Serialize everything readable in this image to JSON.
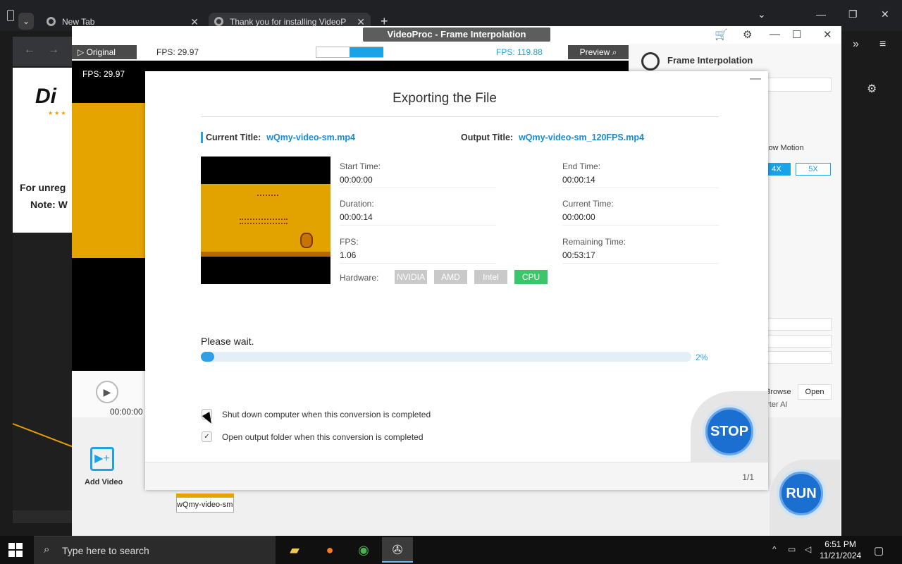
{
  "browser": {
    "tabs": [
      {
        "label": "New Tab"
      },
      {
        "label": "Thank you for installing VideoP"
      }
    ],
    "page": {
      "headline": "Di",
      "line1": "For unreg",
      "line2": "Note: W"
    }
  },
  "app": {
    "window_title": "VideoProc - Frame Interpolation",
    "original_label": "Original",
    "fps_left": "FPS: 29.97",
    "fps_right": "FPS: 119.88",
    "preview_label": "Preview",
    "video_fps_overlay": "FPS: 29.97",
    "time_display": "00:00:00",
    "panel": {
      "title": "Frame Interpolation",
      "slow_motion_label": "low Motion",
      "btn_4x": "4X",
      "btn_5x": "5X",
      "label_4": "4",
      "browse": "Browse",
      "open": "Open",
      "converter": "erter AI"
    },
    "add_video_label": "Add Video",
    "thumb_label": "wQmy-video-sm.",
    "run_label": "RUN"
  },
  "dialog": {
    "title": "Exporting the File",
    "current_title_label": "Current Title:",
    "current_title_value": "wQmy-video-sm.mp4",
    "output_title_label": "Output Title:",
    "output_title_value": "wQmy-video-sm_120FPS.mp4",
    "fields": {
      "start_time_label": "Start Time:",
      "start_time": "00:00:00",
      "end_time_label": "End Time:",
      "end_time": "00:00:14",
      "duration_label": "Duration:",
      "duration": "00:00:14",
      "current_time_label": "Current Time:",
      "current_time": "00:00:00",
      "fps_label": "FPS:",
      "fps": "1.06",
      "remaining_label": "Remaining Time:",
      "remaining": "00:53:17"
    },
    "hardware_label": "Hardware:",
    "hardware": [
      "NVIDIA",
      "AMD",
      "Intel",
      "CPU"
    ],
    "hardware_active": "CPU",
    "status_text": "Please wait.",
    "progress_percent": 2,
    "progress_label": "2%",
    "shutdown_label": "Shut down computer when this conversion is completed",
    "shutdown_checked": false,
    "open_folder_label": "Open output folder when this conversion is completed",
    "open_folder_checked": true,
    "stop_label": "STOP",
    "page_indicator": "1/1"
  },
  "taskbar": {
    "search_placeholder": "Type here to search",
    "time": "6:51 PM",
    "date": "11/21/2024"
  },
  "colors": {
    "accent": "#1aa3e8",
    "cpu_active": "#3cc56a",
    "button_blue": "#1b6fd1"
  }
}
